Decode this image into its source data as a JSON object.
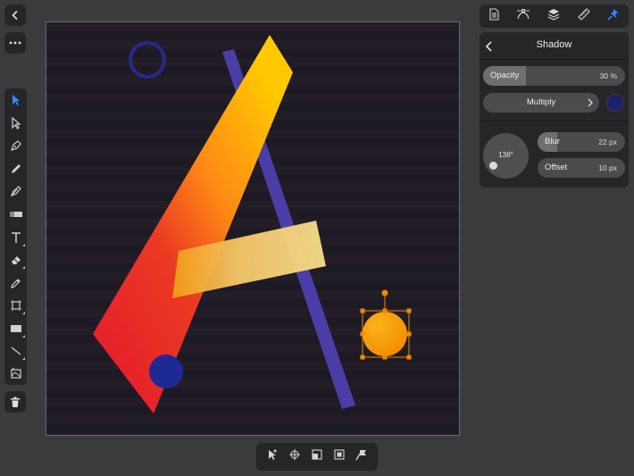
{
  "nav": {
    "back_icon": "chevron-left-icon",
    "more_icon": "ellipsis-icon"
  },
  "tools": [
    {
      "name": "move-tool",
      "icon": "arrow-pointer-icon",
      "active": true
    },
    {
      "name": "node-tool",
      "icon": "hollow-pointer-icon"
    },
    {
      "name": "pen-tool",
      "icon": "pen-nib-icon"
    },
    {
      "name": "pencil-tool",
      "icon": "pencil-icon"
    },
    {
      "name": "vector-brush-tool",
      "icon": "brush-icon"
    },
    {
      "name": "fill-tool",
      "icon": "fill-icon"
    },
    {
      "name": "text-tool",
      "icon": "text-t-icon"
    },
    {
      "name": "eraser-tool",
      "icon": "eraser-icon"
    },
    {
      "name": "color-picker-tool",
      "icon": "eyedropper-icon"
    },
    {
      "name": "artboard-tool",
      "icon": "artboard-icon"
    },
    {
      "name": "rectangle-tool",
      "icon": "rectangle-icon"
    },
    {
      "name": "line-tool",
      "icon": "line-icon"
    },
    {
      "name": "place-image-tool",
      "icon": "image-place-icon"
    }
  ],
  "bottom_toolbar": [
    "select-all-icon",
    "crosshair-icon",
    "arrange-back-icon",
    "arrange-front-icon",
    "pin-icon"
  ],
  "top_tabs": [
    {
      "name": "document-tab",
      "icon": "document-icon"
    },
    {
      "name": "stroke-tab",
      "icon": "pen-curve-icon"
    },
    {
      "name": "layers-tab",
      "icon": "layers-icon"
    },
    {
      "name": "transform-tab",
      "icon": "ruler-icon"
    },
    {
      "name": "effects-tab",
      "icon": "pin-icon",
      "active": true
    }
  ],
  "panel": {
    "title": "Shadow",
    "opacity": {
      "label": "Opacity",
      "value": "30 %",
      "fraction": 0.3
    },
    "blend_mode": "Multiply",
    "shadow_color": "#1d1f6e",
    "angle": "138°",
    "blur": {
      "label": "Blur",
      "value": "22 px",
      "fraction": 0.22
    },
    "offset": {
      "label": "Offset",
      "value": "10 px",
      "fraction": 0.0
    }
  },
  "colors": {
    "accent": "#2f8cff",
    "background": "#3b3b3d",
    "canvas": "#1f1b24"
  }
}
